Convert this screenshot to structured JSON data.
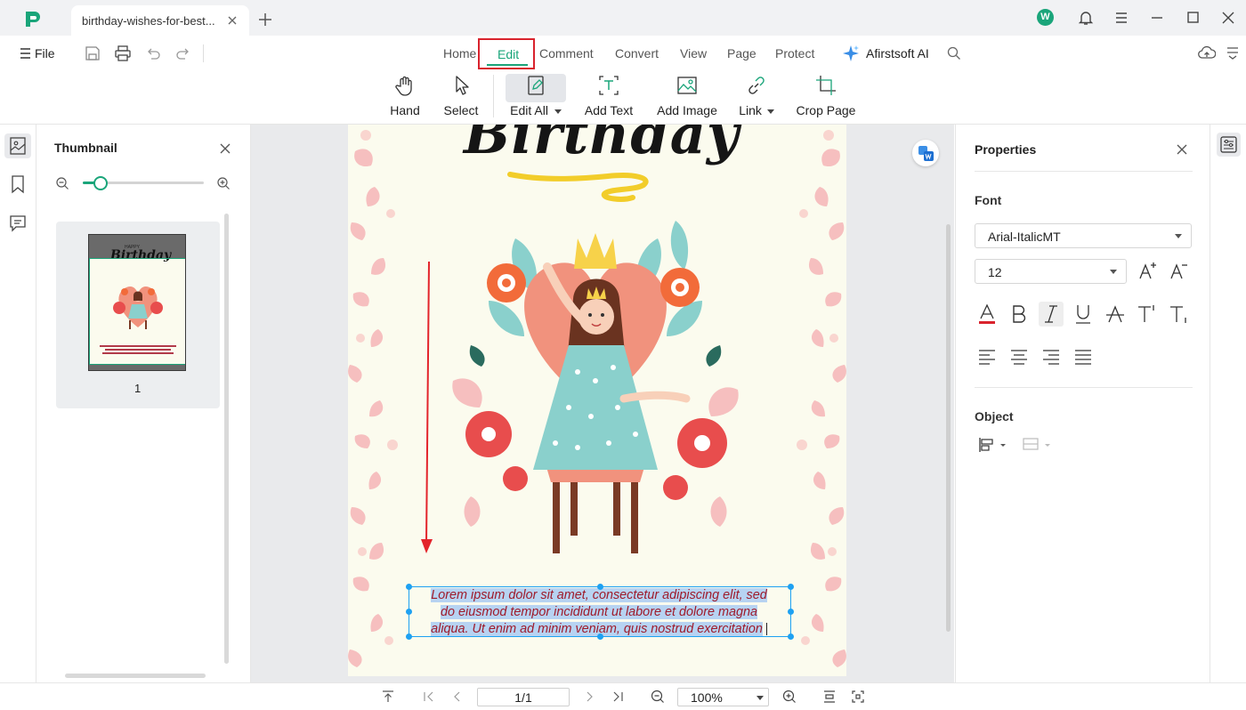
{
  "app": {
    "tab_title": "birthday-wishes-for-best...",
    "user_initial": "W"
  },
  "menu": {
    "file_label": "File",
    "tabs": [
      "Home",
      "Edit",
      "Comment",
      "Convert",
      "View",
      "Page",
      "Protect"
    ],
    "active_tab": "Edit",
    "ai_label": "Afirstsoft AI"
  },
  "ribbon": {
    "tools": [
      {
        "label": "Hand",
        "icon": "hand-icon"
      },
      {
        "label": "Select",
        "icon": "cursor-icon"
      },
      {
        "label": "Edit All",
        "icon": "edit-all-icon",
        "dropdown": true,
        "active": true
      },
      {
        "label": "Add Text",
        "icon": "add-text-icon"
      },
      {
        "label": "Add Image",
        "icon": "add-image-icon"
      },
      {
        "label": "Link",
        "icon": "link-icon",
        "dropdown": true
      },
      {
        "label": "Crop Page",
        "icon": "crop-icon"
      }
    ]
  },
  "thumbnail": {
    "title": "Thumbnail",
    "zoom_level": 0.15,
    "pages": [
      {
        "number": "1"
      }
    ],
    "mini_happy": "HAPPY",
    "mini_birthday": "Birthday"
  },
  "document": {
    "heading": "Birthday",
    "paragraph_lines": [
      "Lorem ipsum dolor sit amet, consectetur adipiscing elit, sed",
      "do eiusmod tempor incididunt ut labore et dolore magna",
      "aliqua. Ut enim ad minim veniam, quis nostrud exercitation"
    ]
  },
  "properties": {
    "title": "Properties",
    "font_section": "Font",
    "font_name": "Arial-ItalicMT",
    "font_size": "12",
    "format_icons": [
      "font-color-icon",
      "bold-icon",
      "italic-icon",
      "underline-icon",
      "strikethrough-icon",
      "superscript-icon",
      "subscript-icon"
    ],
    "align_icons": [
      "align-left-icon",
      "align-center-icon",
      "align-right-icon",
      "align-justify-icon"
    ],
    "object_section": "Object"
  },
  "statusbar": {
    "page_indicator": "1/1",
    "zoom": "100%"
  },
  "colors": {
    "accent": "#1aa57a",
    "highlight_box": "#d9232d",
    "selection": "#1ea1f2",
    "titlebar_bg": "#f1f2f4",
    "canvas_bg": "#e9eaec",
    "page_bg": "#fbfbee",
    "text_color": "#9e1b2b"
  }
}
